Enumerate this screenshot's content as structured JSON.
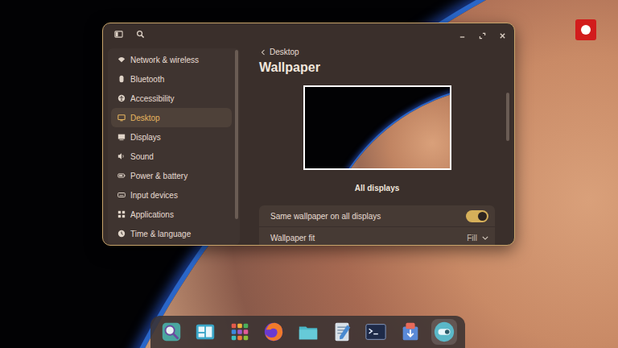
{
  "window": {
    "back": "Desktop",
    "title": "Wallpaper"
  },
  "sidebar": {
    "items": [
      {
        "label": "Network & wireless",
        "selected": false
      },
      {
        "label": "Bluetooth",
        "selected": false
      },
      {
        "label": "Accessibility",
        "selected": false
      },
      {
        "label": "Desktop",
        "selected": true
      },
      {
        "label": "Displays",
        "selected": false
      },
      {
        "label": "Sound",
        "selected": false
      },
      {
        "label": "Power & battery",
        "selected": false
      },
      {
        "label": "Input devices",
        "selected": false
      },
      {
        "label": "Applications",
        "selected": false
      },
      {
        "label": "Time & language",
        "selected": false
      }
    ]
  },
  "preview": {
    "label": "All displays"
  },
  "settings": [
    {
      "kind": "toggle",
      "label": "Same wallpaper on all displays",
      "on": true
    },
    {
      "kind": "dropdown",
      "label": "Wallpaper fit",
      "value": "Fill"
    }
  ],
  "recorder": {
    "recording": true
  },
  "dock": [
    {
      "kind": "search",
      "active": false
    },
    {
      "kind": "workspaces",
      "active": false
    },
    {
      "kind": "apps",
      "active": false
    },
    {
      "kind": "browser",
      "active": false
    },
    {
      "kind": "files",
      "active": false
    },
    {
      "kind": "editor",
      "active": false
    },
    {
      "kind": "terminal",
      "active": false
    },
    {
      "kind": "store",
      "active": false
    },
    {
      "kind": "settings",
      "active": true
    }
  ]
}
